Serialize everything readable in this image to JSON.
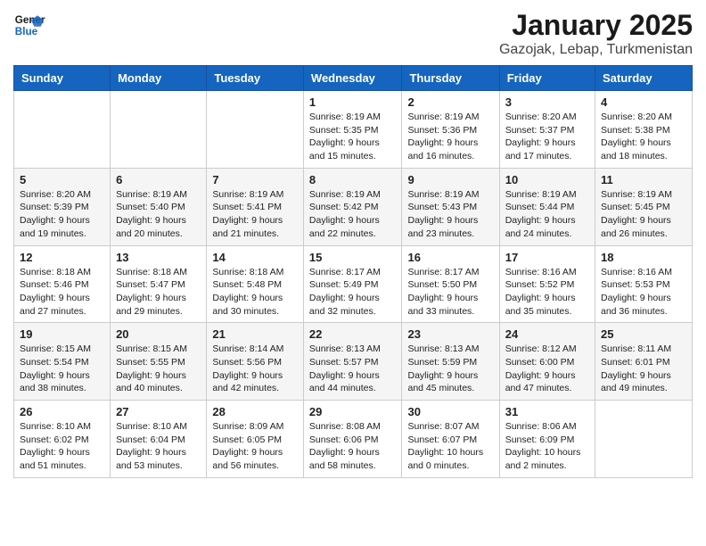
{
  "logo": {
    "line1": "General",
    "line2": "Blue"
  },
  "title": "January 2025",
  "subtitle": "Gazojak, Lebap, Turkmenistan",
  "weekdays": [
    "Sunday",
    "Monday",
    "Tuesday",
    "Wednesday",
    "Thursday",
    "Friday",
    "Saturday"
  ],
  "weeks": [
    [
      {
        "day": "",
        "info": ""
      },
      {
        "day": "",
        "info": ""
      },
      {
        "day": "",
        "info": ""
      },
      {
        "day": "1",
        "info": "Sunrise: 8:19 AM\nSunset: 5:35 PM\nDaylight: 9 hours\nand 15 minutes."
      },
      {
        "day": "2",
        "info": "Sunrise: 8:19 AM\nSunset: 5:36 PM\nDaylight: 9 hours\nand 16 minutes."
      },
      {
        "day": "3",
        "info": "Sunrise: 8:20 AM\nSunset: 5:37 PM\nDaylight: 9 hours\nand 17 minutes."
      },
      {
        "day": "4",
        "info": "Sunrise: 8:20 AM\nSunset: 5:38 PM\nDaylight: 9 hours\nand 18 minutes."
      }
    ],
    [
      {
        "day": "5",
        "info": "Sunrise: 8:20 AM\nSunset: 5:39 PM\nDaylight: 9 hours\nand 19 minutes."
      },
      {
        "day": "6",
        "info": "Sunrise: 8:19 AM\nSunset: 5:40 PM\nDaylight: 9 hours\nand 20 minutes."
      },
      {
        "day": "7",
        "info": "Sunrise: 8:19 AM\nSunset: 5:41 PM\nDaylight: 9 hours\nand 21 minutes."
      },
      {
        "day": "8",
        "info": "Sunrise: 8:19 AM\nSunset: 5:42 PM\nDaylight: 9 hours\nand 22 minutes."
      },
      {
        "day": "9",
        "info": "Sunrise: 8:19 AM\nSunset: 5:43 PM\nDaylight: 9 hours\nand 23 minutes."
      },
      {
        "day": "10",
        "info": "Sunrise: 8:19 AM\nSunset: 5:44 PM\nDaylight: 9 hours\nand 24 minutes."
      },
      {
        "day": "11",
        "info": "Sunrise: 8:19 AM\nSunset: 5:45 PM\nDaylight: 9 hours\nand 26 minutes."
      }
    ],
    [
      {
        "day": "12",
        "info": "Sunrise: 8:18 AM\nSunset: 5:46 PM\nDaylight: 9 hours\nand 27 minutes."
      },
      {
        "day": "13",
        "info": "Sunrise: 8:18 AM\nSunset: 5:47 PM\nDaylight: 9 hours\nand 29 minutes."
      },
      {
        "day": "14",
        "info": "Sunrise: 8:18 AM\nSunset: 5:48 PM\nDaylight: 9 hours\nand 30 minutes."
      },
      {
        "day": "15",
        "info": "Sunrise: 8:17 AM\nSunset: 5:49 PM\nDaylight: 9 hours\nand 32 minutes."
      },
      {
        "day": "16",
        "info": "Sunrise: 8:17 AM\nSunset: 5:50 PM\nDaylight: 9 hours\nand 33 minutes."
      },
      {
        "day": "17",
        "info": "Sunrise: 8:16 AM\nSunset: 5:52 PM\nDaylight: 9 hours\nand 35 minutes."
      },
      {
        "day": "18",
        "info": "Sunrise: 8:16 AM\nSunset: 5:53 PM\nDaylight: 9 hours\nand 36 minutes."
      }
    ],
    [
      {
        "day": "19",
        "info": "Sunrise: 8:15 AM\nSunset: 5:54 PM\nDaylight: 9 hours\nand 38 minutes."
      },
      {
        "day": "20",
        "info": "Sunrise: 8:15 AM\nSunset: 5:55 PM\nDaylight: 9 hours\nand 40 minutes."
      },
      {
        "day": "21",
        "info": "Sunrise: 8:14 AM\nSunset: 5:56 PM\nDaylight: 9 hours\nand 42 minutes."
      },
      {
        "day": "22",
        "info": "Sunrise: 8:13 AM\nSunset: 5:57 PM\nDaylight: 9 hours\nand 44 minutes."
      },
      {
        "day": "23",
        "info": "Sunrise: 8:13 AM\nSunset: 5:59 PM\nDaylight: 9 hours\nand 45 minutes."
      },
      {
        "day": "24",
        "info": "Sunrise: 8:12 AM\nSunset: 6:00 PM\nDaylight: 9 hours\nand 47 minutes."
      },
      {
        "day": "25",
        "info": "Sunrise: 8:11 AM\nSunset: 6:01 PM\nDaylight: 9 hours\nand 49 minutes."
      }
    ],
    [
      {
        "day": "26",
        "info": "Sunrise: 8:10 AM\nSunset: 6:02 PM\nDaylight: 9 hours\nand 51 minutes."
      },
      {
        "day": "27",
        "info": "Sunrise: 8:10 AM\nSunset: 6:04 PM\nDaylight: 9 hours\nand 53 minutes."
      },
      {
        "day": "28",
        "info": "Sunrise: 8:09 AM\nSunset: 6:05 PM\nDaylight: 9 hours\nand 56 minutes."
      },
      {
        "day": "29",
        "info": "Sunrise: 8:08 AM\nSunset: 6:06 PM\nDaylight: 9 hours\nand 58 minutes."
      },
      {
        "day": "30",
        "info": "Sunrise: 8:07 AM\nSunset: 6:07 PM\nDaylight: 10 hours\nand 0 minutes."
      },
      {
        "day": "31",
        "info": "Sunrise: 8:06 AM\nSunset: 6:09 PM\nDaylight: 10 hours\nand 2 minutes."
      },
      {
        "day": "",
        "info": ""
      }
    ]
  ]
}
